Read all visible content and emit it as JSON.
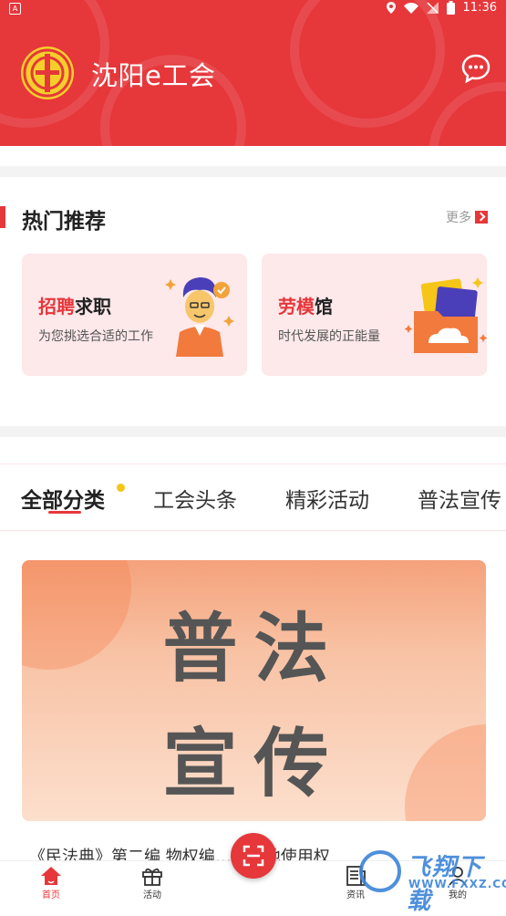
{
  "status_bar": {
    "left_badge": "A",
    "time": "11:36"
  },
  "header": {
    "title": "沈阳e工会",
    "colors": {
      "brand": "#e6373b",
      "logo": "#f4cf2a"
    },
    "icons": [
      "union-logo-icon",
      "chat-icon"
    ]
  },
  "hot": {
    "title": "热门推荐",
    "more_label": "更多",
    "cards": [
      {
        "title_highlight": "招聘",
        "title_rest": "求职",
        "subtitle": "为您挑选合适的工作",
        "icon": "worker-avatar-icon"
      },
      {
        "title_highlight": "劳模",
        "title_rest": "馆",
        "subtitle": "时代发展的正能量",
        "icon": "photo-folder-icon"
      }
    ]
  },
  "tabs": [
    {
      "label": "全部分类",
      "active": true
    },
    {
      "label": "工会头条",
      "active": false
    },
    {
      "label": "精彩活动",
      "active": false
    },
    {
      "label": "普法宣传",
      "active": false
    }
  ],
  "banner": {
    "line1": "普法",
    "line2": "宣传"
  },
  "article": {
    "title": "《民法典》第二编 物权编……用地使用权"
  },
  "bottom_nav": [
    {
      "label": "首页",
      "icon": "home-icon",
      "active": true
    },
    {
      "label": "活动",
      "icon": "gift-icon",
      "active": false
    },
    {
      "label": "资讯",
      "icon": "news-icon",
      "active": false
    },
    {
      "label": "我的",
      "icon": "profile-icon",
      "active": false
    }
  ],
  "watermark": {
    "main": "飞翔下载",
    "sub": "WWW.FXXZ.COM"
  }
}
